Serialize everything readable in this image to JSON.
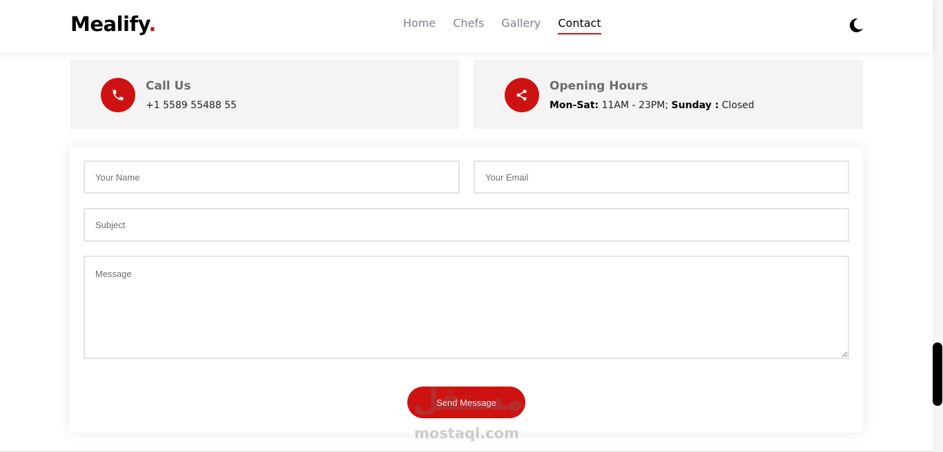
{
  "brand": {
    "name": "Mealify",
    "dot": "."
  },
  "nav": {
    "items": [
      {
        "label": "Home"
      },
      {
        "label": "Chefs"
      },
      {
        "label": "Gallery"
      },
      {
        "label": "Contact",
        "active": true
      }
    ]
  },
  "theme_icon": "moon-icon",
  "info": {
    "call": {
      "icon": "phone-icon",
      "title": "Call Us",
      "text": "+1 5589 55488 55"
    },
    "hours": {
      "icon": "share-icon",
      "title": "Opening Hours",
      "weekday_label": "Mon-Sat:",
      "weekday_hours": " 11AM - 23PM; ",
      "sunday_label": "Sunday :",
      "sunday_hours": " Closed"
    }
  },
  "form": {
    "name_placeholder": "Your Name",
    "email_placeholder": "Your Email",
    "subject_placeholder": "Subject",
    "message_placeholder": "Message",
    "submit_label": "Send Message"
  },
  "watermark": {
    "arabic": "مستقل",
    "latin": "mostaql.com"
  },
  "colors": {
    "accent": "#ce1212",
    "card_bg": "#f4f4f4"
  }
}
